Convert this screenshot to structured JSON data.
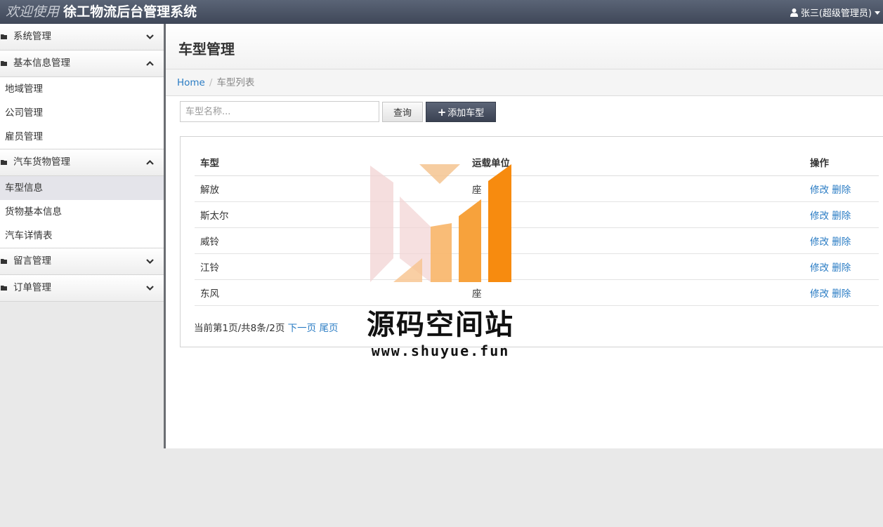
{
  "topbar": {
    "welcome": "欢迎使用",
    "system_name": "徐工物流后台管理系统",
    "user": "张三(超级管理员)"
  },
  "sidebar": {
    "groups": [
      {
        "label": "系统管理",
        "expanded": false,
        "items": []
      },
      {
        "label": "基本信息管理",
        "expanded": true,
        "items": [
          "地域管理",
          "公司管理",
          "雇员管理"
        ]
      },
      {
        "label": "汽车货物管理",
        "expanded": true,
        "items": [
          "车型信息",
          "货物基本信息",
          "汽车详情表"
        ]
      },
      {
        "label": "留言管理",
        "expanded": false,
        "items": []
      },
      {
        "label": "订单管理",
        "expanded": false,
        "items": []
      }
    ],
    "active_item": "车型信息"
  },
  "page": {
    "title": "车型管理",
    "breadcrumb_home": "Home",
    "breadcrumb_current": "车型列表"
  },
  "toolbar": {
    "search_placeholder": "车型名称...",
    "query_label": "查询",
    "add_label": "添加车型"
  },
  "table": {
    "headers": [
      "车型",
      "运载单位",
      "操作"
    ],
    "rows": [
      {
        "type": "解放",
        "unit": "座"
      },
      {
        "type": "斯太尔",
        "unit": ""
      },
      {
        "type": "威铃",
        "unit": ""
      },
      {
        "type": "江铃",
        "unit": ""
      },
      {
        "type": "东风",
        "unit": "座"
      }
    ],
    "edit_label": "修改",
    "delete_label": "删除"
  },
  "pager": {
    "info": "当前第1页/共8条/2页",
    "next": "下一页",
    "last": "尾页"
  },
  "watermark": {
    "title": "源码空间站",
    "url": "www.shuyue.fun"
  }
}
